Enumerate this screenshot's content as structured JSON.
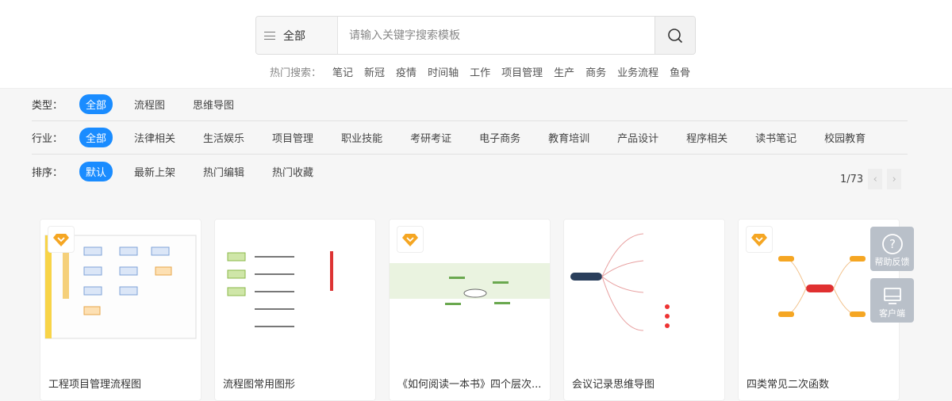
{
  "search": {
    "category": "全部",
    "placeholder": "请输入关键字搜索模板"
  },
  "hot": {
    "label": "热门搜索：",
    "items": [
      "笔记",
      "新冠",
      "疫情",
      "时间轴",
      "工作",
      "项目管理",
      "生产",
      "商务",
      "业务流程",
      "鱼骨"
    ]
  },
  "filters": [
    {
      "label": "类型：",
      "options": [
        "全部",
        "流程图",
        "思维导图"
      ]
    },
    {
      "label": "行业：",
      "options": [
        "全部",
        "法律相关",
        "生活娱乐",
        "项目管理",
        "职业技能",
        "考研考证",
        "电子商务",
        "教育培训",
        "产品设计",
        "程序相关",
        "读书笔记",
        "校园教育"
      ]
    },
    {
      "label": "排序：",
      "options": [
        "默认",
        "最新上架",
        "热门编辑",
        "热门收藏"
      ]
    }
  ],
  "pager": {
    "text": "1/73",
    "prev": "‹",
    "next": "›"
  },
  "cards": [
    {
      "title": "工程项目管理流程图",
      "badge": true
    },
    {
      "title": "流程图常用图形",
      "badge": false
    },
    {
      "title": "《如何阅读一本书》四个层次...",
      "badge": true
    },
    {
      "title": "会议记录思维导图",
      "badge": false
    },
    {
      "title": "四类常见二次函数",
      "badge": true
    }
  ],
  "side": {
    "help": "帮助反馈",
    "client": "客户端"
  },
  "colors": {
    "accent": "#1a8cff",
    "badge": "#f5a623"
  }
}
